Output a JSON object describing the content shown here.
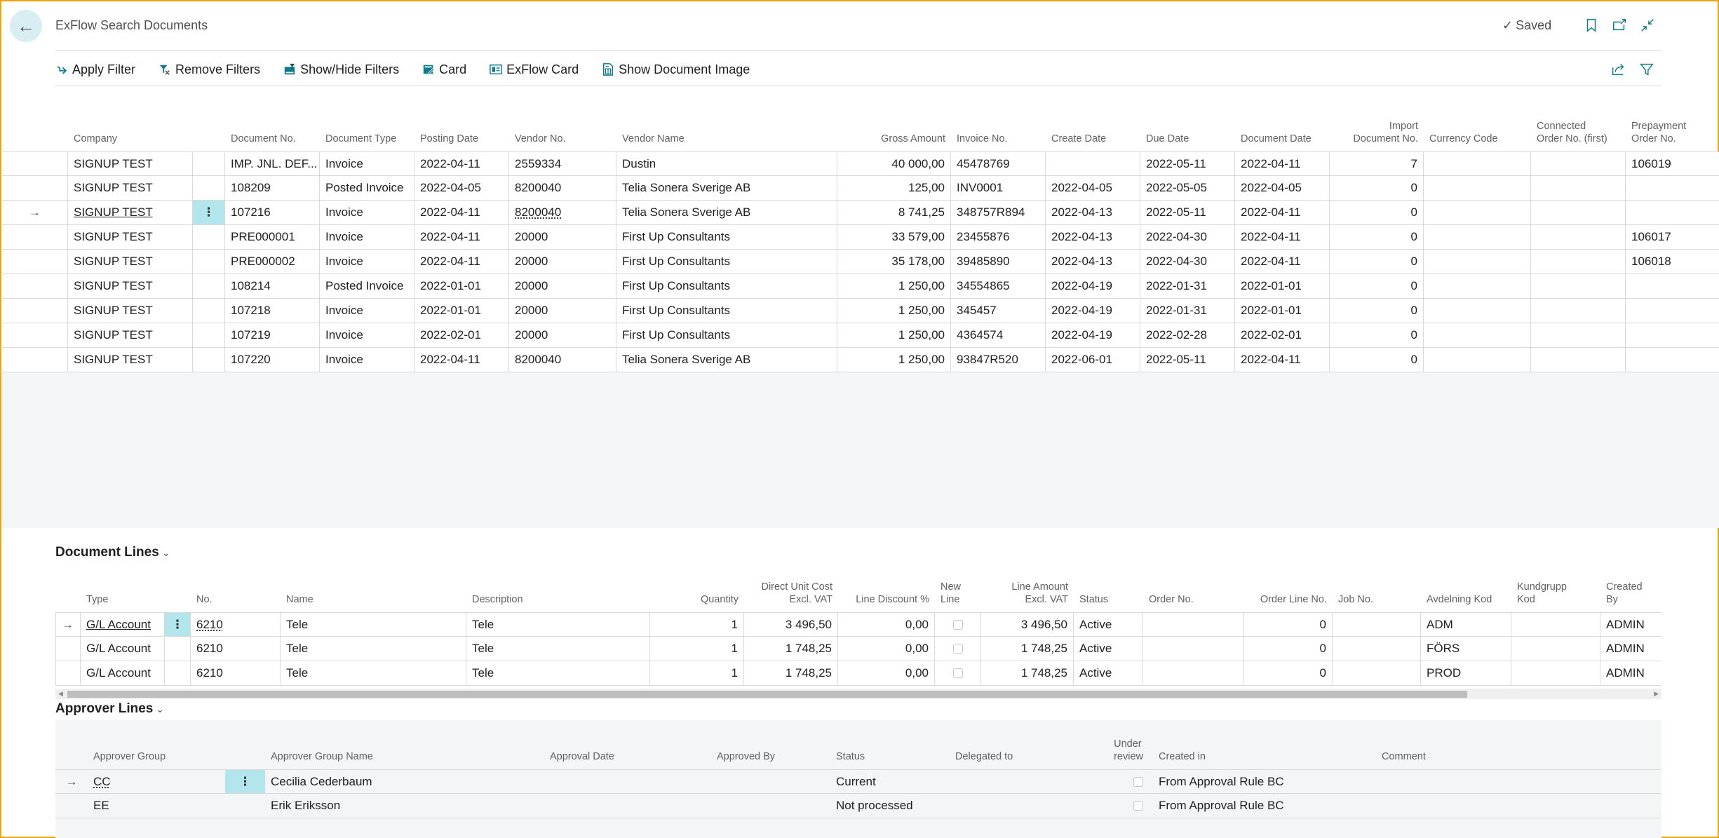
{
  "header": {
    "title": "ExFlow Search Documents",
    "saved_label": "Saved",
    "icons": [
      "back-arrow-icon",
      "bookmark-icon",
      "open-in-new-window-icon",
      "collapse-icon"
    ]
  },
  "toolbar": {
    "actions": [
      {
        "label": "Apply Filter",
        "icon": "apply-filter-icon"
      },
      {
        "label": "Remove Filters",
        "icon": "remove-filters-icon"
      },
      {
        "label": "Show/Hide Filters",
        "icon": "show-hide-filters-icon"
      },
      {
        "label": "Card",
        "icon": "card-icon"
      },
      {
        "label": "ExFlow Card",
        "icon": "exflow-card-icon"
      },
      {
        "label": "Show Document Image",
        "icon": "document-image-icon"
      }
    ],
    "right_icons": [
      "share-icon",
      "filter-icon"
    ]
  },
  "documents": {
    "columns": [
      "Company",
      "Document No.",
      "Document Type",
      "Posting Date",
      "Vendor No.",
      "Vendor Name",
      "Gross Amount",
      "Invoice No.",
      "Create Date",
      "Due Date",
      "Document Date",
      "Import Document No.",
      "Currency Code",
      "Connected Order No. (first)",
      "Prepayment Order No."
    ],
    "column_headers": {
      "company": "Company",
      "doc_no": "Document No.",
      "doc_type": "Document Type",
      "posting_date": "Posting Date",
      "vendor_no": "Vendor No.",
      "vendor_name": "Vendor Name",
      "gross_amount": "Gross Amount",
      "invoice_no": "Invoice No.",
      "create_date": "Create Date",
      "due_date": "Due Date",
      "document_date": "Document Date",
      "import_doc_no_1": "Import",
      "import_doc_no_2": "Document No.",
      "currency_code": "Currency Code",
      "connected_order_1": "Connected",
      "connected_order_2": "Order No. (first)",
      "prepayment_1": "Prepayment",
      "prepayment_2": "Order No."
    },
    "selected_row": 2,
    "rows": [
      {
        "company": "SIGNUP TEST",
        "doc_no": "IMP. JNL. DEF...",
        "doc_type": "Invoice",
        "posting_date": "2022-04-11",
        "vendor_no": "2559334",
        "vendor_name": "Dustin",
        "gross_amount": "40 000,00",
        "invoice_no": "45478769",
        "create_date": "",
        "due_date": "2022-05-11",
        "document_date": "2022-04-11",
        "import_doc_no": "7",
        "currency_code": "",
        "connected_order": "",
        "prepayment_order": "106019"
      },
      {
        "company": "SIGNUP TEST",
        "doc_no": "108209",
        "doc_type": "Posted Invoice",
        "posting_date": "2022-04-05",
        "vendor_no": "8200040",
        "vendor_name": "Telia Sonera Sverige AB",
        "gross_amount": "125,00",
        "invoice_no": "INV0001",
        "create_date": "2022-04-05",
        "due_date": "2022-05-05",
        "document_date": "2022-04-05",
        "import_doc_no": "0",
        "currency_code": "",
        "connected_order": "",
        "prepayment_order": ""
      },
      {
        "company": "SIGNUP TEST",
        "doc_no": "107216",
        "doc_type": "Invoice",
        "posting_date": "2022-04-11",
        "vendor_no": "8200040",
        "vendor_name": "Telia Sonera Sverige AB",
        "gross_amount": "8 741,25",
        "invoice_no": "348757R894",
        "create_date": "2022-04-13",
        "due_date": "2022-05-11",
        "document_date": "2022-04-11",
        "import_doc_no": "0",
        "currency_code": "",
        "connected_order": "",
        "prepayment_order": ""
      },
      {
        "company": "SIGNUP TEST",
        "doc_no": "PRE000001",
        "doc_type": "Invoice",
        "posting_date": "2022-04-11",
        "vendor_no": "20000",
        "vendor_name": "First Up Consultants",
        "gross_amount": "33 579,00",
        "invoice_no": "23455876",
        "create_date": "2022-04-13",
        "due_date": "2022-04-30",
        "document_date": "2022-04-11",
        "import_doc_no": "0",
        "currency_code": "",
        "connected_order": "",
        "prepayment_order": "106017"
      },
      {
        "company": "SIGNUP TEST",
        "doc_no": "PRE000002",
        "doc_type": "Invoice",
        "posting_date": "2022-04-11",
        "vendor_no": "20000",
        "vendor_name": "First Up Consultants",
        "gross_amount": "35 178,00",
        "invoice_no": "39485890",
        "create_date": "2022-04-13",
        "due_date": "2022-04-30",
        "document_date": "2022-04-11",
        "import_doc_no": "0",
        "currency_code": "",
        "connected_order": "",
        "prepayment_order": "106018"
      },
      {
        "company": "SIGNUP TEST",
        "doc_no": "108214",
        "doc_type": "Posted Invoice",
        "posting_date": "2022-01-01",
        "vendor_no": "20000",
        "vendor_name": "First Up Consultants",
        "gross_amount": "1 250,00",
        "invoice_no": "34554865",
        "create_date": "2022-04-19",
        "due_date": "2022-01-31",
        "document_date": "2022-01-01",
        "import_doc_no": "0",
        "currency_code": "",
        "connected_order": "",
        "prepayment_order": ""
      },
      {
        "company": "SIGNUP TEST",
        "doc_no": "107218",
        "doc_type": "Invoice",
        "posting_date": "2022-01-01",
        "vendor_no": "20000",
        "vendor_name": "First Up Consultants",
        "gross_amount": "1 250,00",
        "invoice_no": "345457",
        "create_date": "2022-04-19",
        "due_date": "2022-01-31",
        "document_date": "2022-01-01",
        "import_doc_no": "0",
        "currency_code": "",
        "connected_order": "",
        "prepayment_order": ""
      },
      {
        "company": "SIGNUP TEST",
        "doc_no": "107219",
        "doc_type": "Invoice",
        "posting_date": "2022-02-01",
        "vendor_no": "20000",
        "vendor_name": "First Up Consultants",
        "gross_amount": "1 250,00",
        "invoice_no": "4364574",
        "create_date": "2022-04-19",
        "due_date": "2022-02-28",
        "document_date": "2022-02-01",
        "import_doc_no": "0",
        "currency_code": "",
        "connected_order": "",
        "prepayment_order": ""
      },
      {
        "company": "SIGNUP TEST",
        "doc_no": "107220",
        "doc_type": "Invoice",
        "posting_date": "2022-04-11",
        "vendor_no": "8200040",
        "vendor_name": "Telia Sonera Sverige AB",
        "gross_amount": "1 250,00",
        "invoice_no": "93847R520",
        "create_date": "2022-06-01",
        "due_date": "2022-05-11",
        "document_date": "2022-04-11",
        "import_doc_no": "0",
        "currency_code": "",
        "connected_order": "",
        "prepayment_order": ""
      }
    ]
  },
  "document_lines": {
    "title": "Document Lines",
    "column_headers": {
      "type": "Type",
      "no": "No.",
      "name": "Name",
      "description": "Description",
      "quantity": "Quantity",
      "unit_cost_1": "Direct Unit Cost",
      "unit_cost_2": "Excl. VAT",
      "line_discount": "Line Discount %",
      "new_line_1": "New",
      "new_line_2": "Line",
      "line_amount_1": "Line Amount",
      "line_amount_2": "Excl. VAT",
      "status": "Status",
      "order_no": "Order No.",
      "order_line_no": "Order Line No.",
      "job_no": "Job No.",
      "avdelning": "Avdelning Kod",
      "kundgrupp_1": "Kundgrupp",
      "kundgrupp_2": "Kod",
      "created_by": "Created By"
    },
    "selected_row": 0,
    "rows": [
      {
        "type": "G/L Account",
        "no": "6210",
        "name": "Tele",
        "description": "Tele",
        "quantity": "1",
        "unit_cost": "3 496,50",
        "line_discount": "0,00",
        "new_line": false,
        "line_amount": "3 496,50",
        "status": "Active",
        "order_no": "",
        "order_line_no": "0",
        "job_no": "",
        "avdelning": "ADM",
        "kundgrupp": "",
        "created_by": "ADMIN"
      },
      {
        "type": "G/L Account",
        "no": "6210",
        "name": "Tele",
        "description": "Tele",
        "quantity": "1",
        "unit_cost": "1 748,25",
        "line_discount": "0,00",
        "new_line": false,
        "line_amount": "1 748,25",
        "status": "Active",
        "order_no": "",
        "order_line_no": "0",
        "job_no": "",
        "avdelning": "FÖRS",
        "kundgrupp": "",
        "created_by": "ADMIN"
      },
      {
        "type": "G/L Account",
        "no": "6210",
        "name": "Tele",
        "description": "Tele",
        "quantity": "1",
        "unit_cost": "1 748,25",
        "line_discount": "0,00",
        "new_line": false,
        "line_amount": "1 748,25",
        "status": "Active",
        "order_no": "",
        "order_line_no": "0",
        "job_no": "",
        "avdelning": "PROD",
        "kundgrupp": "",
        "created_by": "ADMIN"
      }
    ]
  },
  "approver_lines": {
    "title": "Approver Lines",
    "column_headers": {
      "group": "Approver Group",
      "group_name": "Approver Group Name",
      "approval_date": "Approval Date",
      "approved_by": "Approved By",
      "status": "Status",
      "delegated_to": "Delegated to",
      "under_review_1": "Under",
      "under_review_2": "review",
      "created_in": "Created in",
      "comment": "Comment"
    },
    "selected_row": 0,
    "rows": [
      {
        "group": "CC",
        "group_name": "Cecilia Cederbaum",
        "approval_date": "",
        "approved_by": "",
        "status": "Current",
        "delegated_to": "",
        "under_review": false,
        "created_in": "From Approval Rule BC",
        "comment": ""
      },
      {
        "group": "EE",
        "group_name": "Erik Eriksson",
        "approval_date": "",
        "approved_by": "",
        "status": "Not processed",
        "delegated_to": "",
        "under_review": false,
        "created_in": "From Approval Rule BC",
        "comment": ""
      }
    ]
  },
  "colors": {
    "accent": "#0f7b8a",
    "selection": "#b3e6ec",
    "window_border": "#f0a30a",
    "panel_bg": "#f4f5f7"
  }
}
